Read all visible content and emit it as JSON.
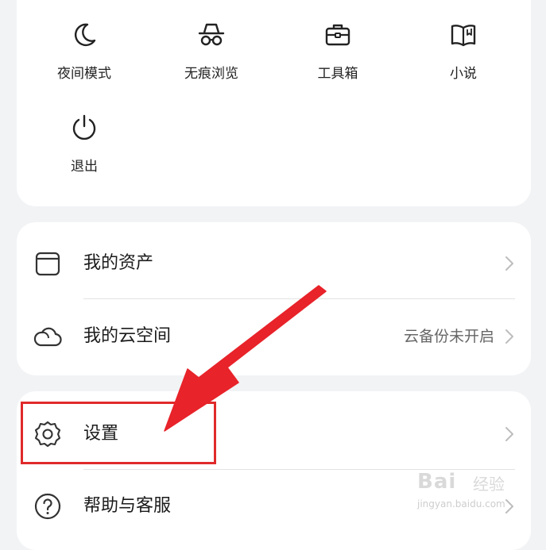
{
  "tools": {
    "items": [
      {
        "label": "夜间模式",
        "icon": "moon-icon"
      },
      {
        "label": "无痕浏览",
        "icon": "incognito-icon"
      },
      {
        "label": "工具箱",
        "icon": "toolbox-icon"
      },
      {
        "label": "小说",
        "icon": "book-icon"
      },
      {
        "label": "退出",
        "icon": "power-icon"
      }
    ]
  },
  "assets": {
    "my_assets_label": "我的资产",
    "my_assets_icon": "wallet-icon",
    "cloud_label": "我的云空间",
    "cloud_icon": "cloud-icon",
    "cloud_status": "云备份未开启"
  },
  "settings": {
    "settings_label": "设置",
    "settings_icon": "gear-icon",
    "help_label": "帮助与客服",
    "help_icon": "question-icon"
  },
  "annotation": {
    "highlight_color": "#e02a2a",
    "arrow_color": "#e8232a"
  },
  "watermark": {
    "brand": "Bai",
    "sub": "经验",
    "url": "jingyan.baidu.com"
  }
}
